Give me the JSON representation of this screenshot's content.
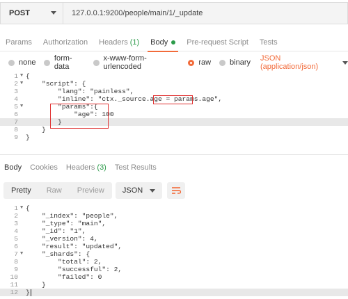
{
  "request": {
    "method": "POST",
    "url": "127.0.0.1:9200/people/main/1/_update"
  },
  "request_tabs": [
    {
      "label": "Params"
    },
    {
      "label": "Authorization"
    },
    {
      "label": "Headers",
      "count": "(1)"
    },
    {
      "label": "Body",
      "active": true
    },
    {
      "label": "Pre-request Script"
    },
    {
      "label": "Tests"
    }
  ],
  "body_types": {
    "none": "none",
    "form_data": "form-data",
    "urlencoded": "x-www-form-urlencoded",
    "raw": "raw",
    "binary": "binary",
    "content_type": "JSON (application/json)"
  },
  "request_body": {
    "lines": [
      {
        "n": "1",
        "fold": "▼",
        "code": "{"
      },
      {
        "n": "2",
        "fold": "▼",
        "code": "    \"script\": {"
      },
      {
        "n": "3",
        "fold": "",
        "code": "        \"lang\": \"painless\","
      },
      {
        "n": "4",
        "fold": "",
        "code": "        \"inline\": \"ctx._source.age = params.age\","
      },
      {
        "n": "5",
        "fold": "▼",
        "code": "        \"params\":{"
      },
      {
        "n": "6",
        "fold": "",
        "code": "            \"age\": 100"
      },
      {
        "n": "7",
        "fold": "",
        "code": "        }",
        "highlight": true
      },
      {
        "n": "8",
        "fold": "",
        "code": "    }"
      },
      {
        "n": "9",
        "fold": "",
        "code": "}"
      }
    ]
  },
  "response_tabs": [
    {
      "label": "Body",
      "active": true
    },
    {
      "label": "Cookies"
    },
    {
      "label": "Headers",
      "count": "(3)"
    },
    {
      "label": "Test Results"
    }
  ],
  "response_toolbar": {
    "pretty": "Pretty",
    "raw": "Raw",
    "preview": "Preview",
    "format": "JSON",
    "wrap_icon": "wrap-lines-icon"
  },
  "response_body": {
    "lines": [
      {
        "n": "1",
        "fold": "▼",
        "code": "{"
      },
      {
        "n": "2",
        "fold": "",
        "code": "    \"_index\": \"people\","
      },
      {
        "n": "3",
        "fold": "",
        "code": "    \"_type\": \"main\","
      },
      {
        "n": "4",
        "fold": "",
        "code": "    \"_id\": \"1\","
      },
      {
        "n": "5",
        "fold": "",
        "code": "    \"_version\": 4,"
      },
      {
        "n": "6",
        "fold": "",
        "code": "    \"result\": \"updated\","
      },
      {
        "n": "7",
        "fold": "▼",
        "code": "    \"_shards\": {"
      },
      {
        "n": "8",
        "fold": "",
        "code": "        \"total\": 2,"
      },
      {
        "n": "9",
        "fold": "",
        "code": "        \"successful\": 2,"
      },
      {
        "n": "10",
        "fold": "",
        "code": "        \"failed\": 0"
      },
      {
        "n": "11",
        "fold": "",
        "code": "    }"
      },
      {
        "n": "12",
        "fold": "",
        "code": "}",
        "highlight": true
      }
    ]
  },
  "colors": {
    "accent": "#f26b3a",
    "count_green": "#2c9b4a",
    "annotation_red": "#e03030"
  }
}
